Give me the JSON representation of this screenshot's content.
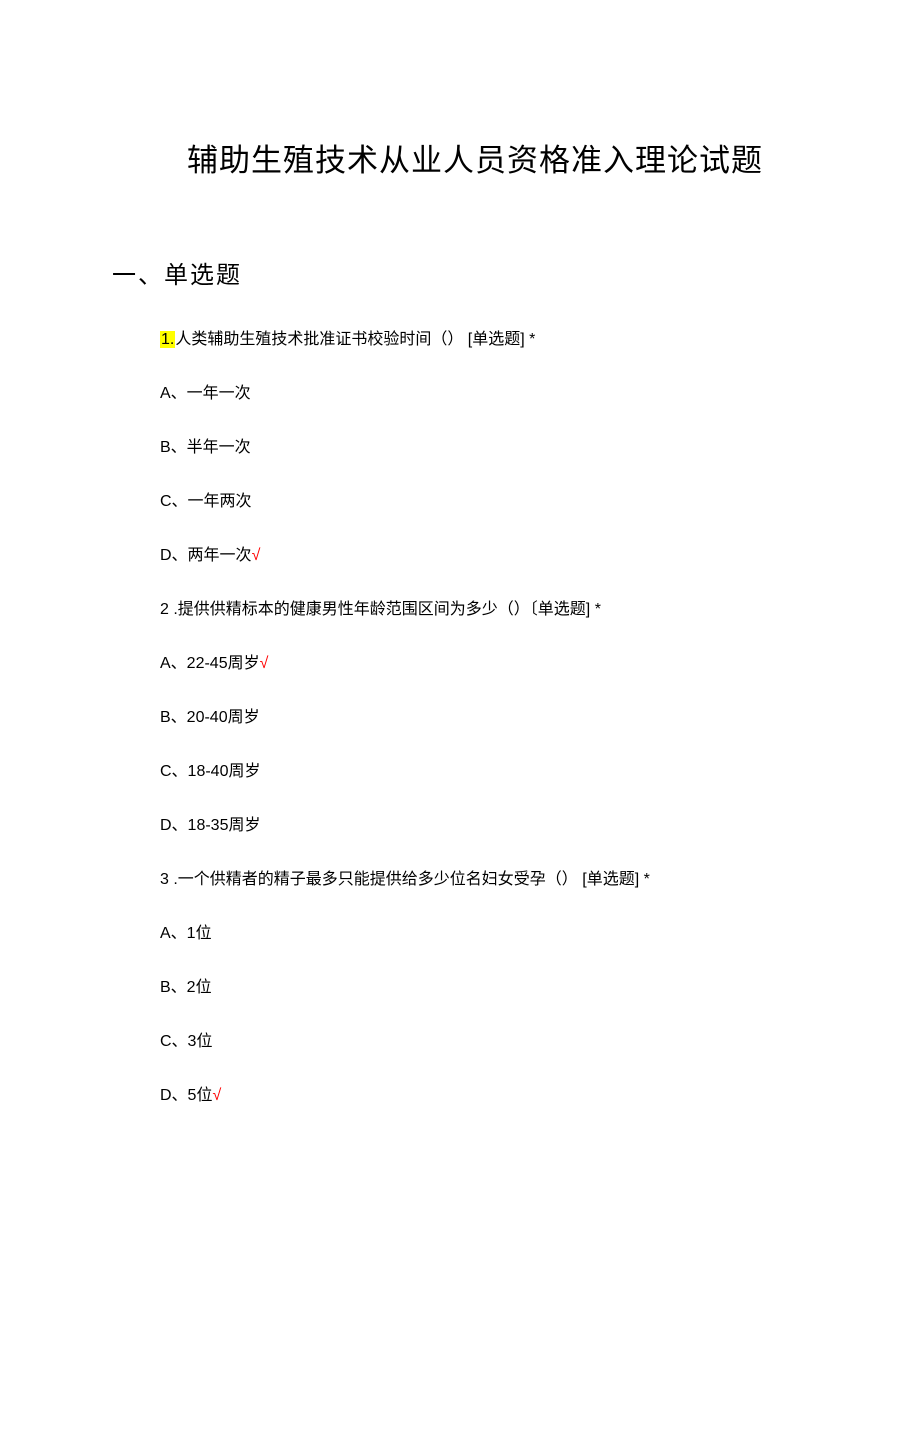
{
  "title": "辅助生殖技术从业人员资格准入理论试题",
  "section": "一、单选题",
  "q1": {
    "num": "1.",
    "text": "人类辅助生殖技术批准证书校验时间（）  [单选题] *",
    "a": "A、一年一次",
    "b": "B、半年一次",
    "c": "C、一年两次",
    "d": "D、两年一次",
    "d_mark": "√"
  },
  "q2": {
    "num": "2",
    "text": "  .提供供精标本的健康男性年龄范围区间为多少（）〔单选题] *",
    "a": "A、22-45周岁",
    "a_mark": "√",
    "b": "B、20-40周岁",
    "c": "C、18-40周岁",
    "d": "D、18-35周岁"
  },
  "q3": {
    "num": "3",
    "text": "  .一个供精者的精子最多只能提供给多少位名妇女受孕（）  [单选题]  *",
    "a": "A、1位",
    "b": "B、2位",
    "c": "C、3位",
    "d": "D、5位",
    "d_mark": "√"
  }
}
